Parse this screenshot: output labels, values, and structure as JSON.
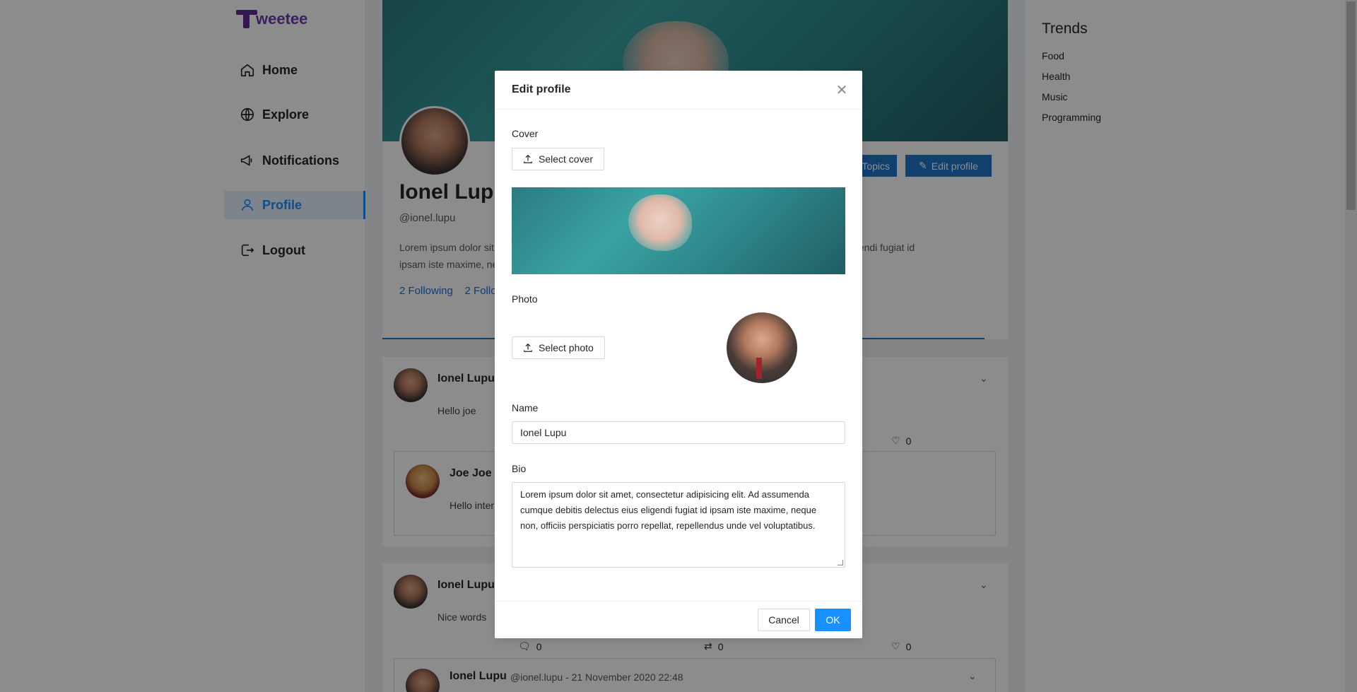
{
  "app": {
    "name": "weetee"
  },
  "nav": {
    "items": [
      {
        "label": "Home",
        "icon": "home-icon"
      },
      {
        "label": "Explore",
        "icon": "globe-icon"
      },
      {
        "label": "Notifications",
        "icon": "megaphone-icon"
      },
      {
        "label": "Profile",
        "icon": "user-icon",
        "active": true
      },
      {
        "label": "Logout",
        "icon": "logout-icon"
      }
    ]
  },
  "profile": {
    "name": "Ionel Lupu",
    "handle": "@ionel.lupu",
    "bio_line1": "Lorem ipsum dolor sit amet, consectetur adipisicing elit. Ad assumenda cumque debitis delectus eius eligendi fugiat id",
    "bio_line2": "ipsam iste maxime, neque non, officiis perspiciatis porro repellat, repellendus unde vel voluptatibus.",
    "following": "2 Following",
    "followers": "2 Followers",
    "topics_label": "Topics",
    "edit_label": "Edit profile"
  },
  "posts": [
    {
      "author": "Ionel Lupu",
      "text": "Hello joe",
      "likes": "0",
      "quote": {
        "author": "Joe Joe",
        "text": "Hello internet"
      }
    },
    {
      "author": "Ionel Lupu",
      "text": "Nice words",
      "comments": "0",
      "retweets": "0",
      "likes": "0",
      "quote": {
        "author": "Ionel Lupu",
        "meta": "@ionel.lupu - 21 November 2020 22:48"
      }
    }
  ],
  "trends": {
    "title": "Trends",
    "items": [
      "Food",
      "Health",
      "Music",
      "Programming"
    ]
  },
  "modal": {
    "title": "Edit profile",
    "cover_label": "Cover",
    "select_cover": "Select cover",
    "photo_label": "Photo",
    "select_photo": "Select photo",
    "name_label": "Name",
    "name_value": "Ionel Lupu",
    "bio_label": "Bio",
    "bio_value": "Lorem ipsum dolor sit amet, consectetur adipisicing elit. Ad assumenda cumque debitis delectus eius eligendi fugiat id ipsam iste maxime, neque non, officiis perspiciatis porro repellat, repellendus unde vel voluptatibus.",
    "cancel": "Cancel",
    "ok": "OK"
  },
  "colors": {
    "accent": "#1890ff",
    "brand": "#6a3bb0",
    "profile_button": "#1f73c8"
  }
}
